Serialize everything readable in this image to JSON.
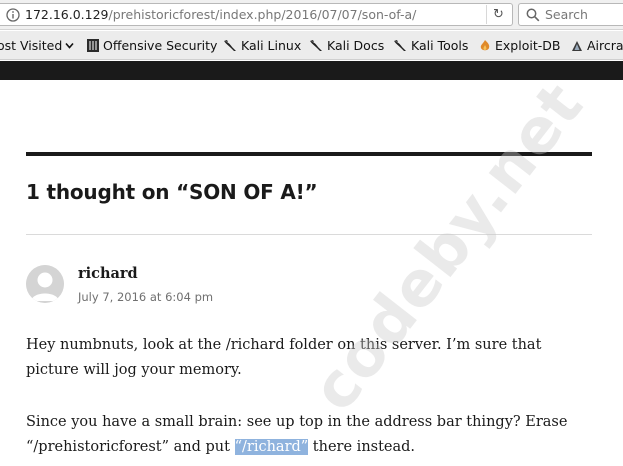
{
  "browser": {
    "url_host": "172.16.0.129",
    "url_path": "/prehistoricforest/index.php/2016/07/07/son-of-a/",
    "search_placeholder": "Search"
  },
  "bookmarks": [
    {
      "label": "ost Visited",
      "icon": "chevron-down-icon"
    },
    {
      "label": "Offensive Security",
      "icon": "offsec-icon"
    },
    {
      "label": "Kali Linux",
      "icon": "kali-dragon-icon"
    },
    {
      "label": "Kali Docs",
      "icon": "kali-dragon-icon"
    },
    {
      "label": "Kali Tools",
      "icon": "kali-dragon-icon"
    },
    {
      "label": "Exploit-DB",
      "icon": "exploit-db-icon"
    },
    {
      "label": "Aircrack-ng",
      "icon": "aircrack-icon"
    }
  ],
  "comments": {
    "title": "1 thought on “SON OF A!”",
    "author": "richard",
    "date": "July 7, 2016 at 6:04 pm",
    "paragraph1": "Hey numbnuts, look at the /richard folder on this server. I’m sure that picture will jog your memory.",
    "paragraph2_before": "Since you have a small brain: see up top in the address bar thingy? Erase “/prehistoricforest” and put ",
    "paragraph2_highlight": "“/richard”",
    "paragraph2_after": " there instead."
  },
  "watermark": "codeby.net",
  "colors": {
    "header_bar": "#1a1a1a",
    "selection": "#8fb3de",
    "text": "#1a1a1a"
  }
}
